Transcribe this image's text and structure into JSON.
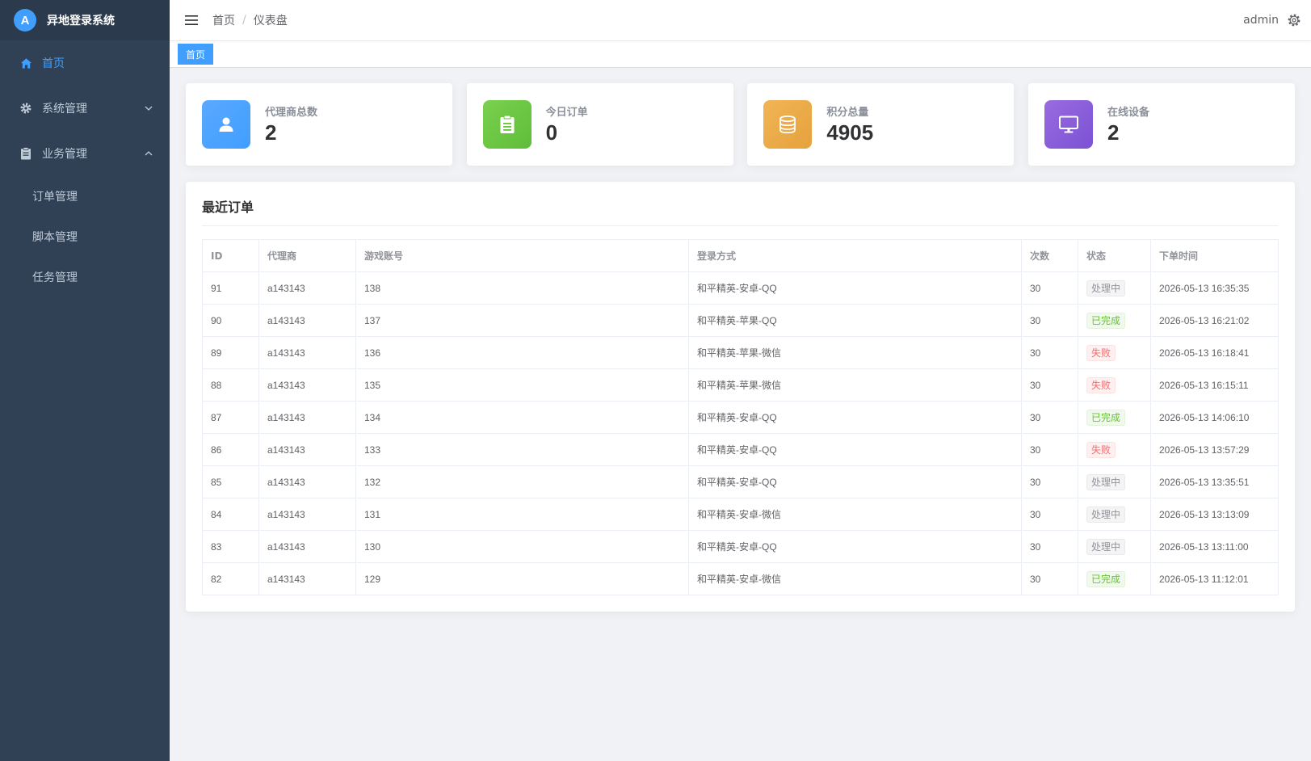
{
  "app": {
    "logo_letter": "A",
    "title": "异地登录系统"
  },
  "sidebar": {
    "items": [
      {
        "label": "首页",
        "icon": "home-icon"
      },
      {
        "label": "系统管理",
        "icon": "gear-icon"
      },
      {
        "label": "业务管理",
        "icon": "clipboard-icon"
      }
    ],
    "subitems": [
      {
        "label": "订单管理"
      },
      {
        "label": "脚本管理"
      },
      {
        "label": "任务管理"
      }
    ]
  },
  "header": {
    "breadcrumb": [
      "首页",
      "仪表盘"
    ],
    "separator": "/",
    "user": "admin"
  },
  "tags": {
    "active": "首页"
  },
  "stats": [
    {
      "label": "代理商总数",
      "value": "2",
      "icon": "user-icon",
      "color": "#409eff"
    },
    {
      "label": "今日订单",
      "value": "0",
      "icon": "clipboard-icon",
      "color": "#67c23a"
    },
    {
      "label": "积分总量",
      "value": "4905",
      "icon": "database-icon",
      "color": "#e6a23c"
    },
    {
      "label": "在线设备",
      "value": "2",
      "icon": "monitor-icon",
      "color": "#7b52d4"
    }
  ],
  "orders": {
    "title": "最近订单",
    "columns": [
      "ID",
      "代理商",
      "游戏账号",
      "登录方式",
      "次数",
      "状态",
      "下单时间"
    ],
    "rows": [
      {
        "id": "91",
        "agent": "a143143",
        "account": "138",
        "method": "和平精英-安卓-QQ",
        "count": "30",
        "status": "处理中",
        "status_type": "processing",
        "time": "2026-05-13 16:35:35"
      },
      {
        "id": "90",
        "agent": "a143143",
        "account": "137",
        "method": "和平精英-苹果-QQ",
        "count": "30",
        "status": "已完成",
        "status_type": "done",
        "time": "2026-05-13 16:21:02"
      },
      {
        "id": "89",
        "agent": "a143143",
        "account": "136",
        "method": "和平精英-苹果-微信",
        "count": "30",
        "status": "失败",
        "status_type": "fail",
        "time": "2026-05-13 16:18:41"
      },
      {
        "id": "88",
        "agent": "a143143",
        "account": "135",
        "method": "和平精英-苹果-微信",
        "count": "30",
        "status": "失败",
        "status_type": "fail",
        "time": "2026-05-13 16:15:11"
      },
      {
        "id": "87",
        "agent": "a143143",
        "account": "134",
        "method": "和平精英-安卓-QQ",
        "count": "30",
        "status": "已完成",
        "status_type": "done",
        "time": "2026-05-13 14:06:10"
      },
      {
        "id": "86",
        "agent": "a143143",
        "account": "133",
        "method": "和平精英-安卓-QQ",
        "count": "30",
        "status": "失败",
        "status_type": "fail",
        "time": "2026-05-13 13:57:29"
      },
      {
        "id": "85",
        "agent": "a143143",
        "account": "132",
        "method": "和平精英-安卓-QQ",
        "count": "30",
        "status": "处理中",
        "status_type": "processing",
        "time": "2026-05-13 13:35:51"
      },
      {
        "id": "84",
        "agent": "a143143",
        "account": "131",
        "method": "和平精英-安卓-微信",
        "count": "30",
        "status": "处理中",
        "status_type": "processing",
        "time": "2026-05-13 13:13:09"
      },
      {
        "id": "83",
        "agent": "a143143",
        "account": "130",
        "method": "和平精英-安卓-QQ",
        "count": "30",
        "status": "处理中",
        "status_type": "processing",
        "time": "2026-05-13 13:11:00"
      },
      {
        "id": "82",
        "agent": "a143143",
        "account": "129",
        "method": "和平精英-安卓-微信",
        "count": "30",
        "status": "已完成",
        "status_type": "done",
        "time": "2026-05-13 11:12:01"
      }
    ]
  }
}
